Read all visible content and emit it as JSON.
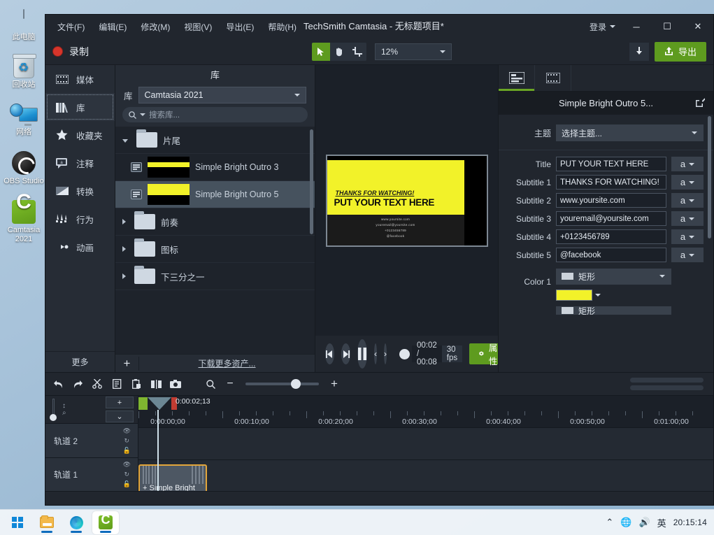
{
  "desktop": {
    "icons": [
      {
        "label": "此电脑",
        "icon": "this-pc-icon"
      },
      {
        "label": "回收站",
        "icon": "recycle-bin-icon"
      },
      {
        "label": "网络",
        "icon": "network-icon"
      },
      {
        "label": "OBS Studio",
        "icon": "obs-studio-icon"
      },
      {
        "label": "Camtasia 2021",
        "icon": "camtasia-icon"
      }
    ]
  },
  "taskbar": {
    "items": [
      {
        "name": "start-button",
        "icon": "windows-logo-icon"
      },
      {
        "name": "file-explorer",
        "icon": "folder-icon"
      },
      {
        "name": "microsoft-edge",
        "icon": "edge-icon"
      },
      {
        "name": "camtasia-taskbar",
        "icon": "camtasia-icon"
      }
    ],
    "tray": {
      "chevron": "⌃",
      "network": "network-icon",
      "volume": "volume-icon",
      "ime": "英"
    },
    "clock": "20:15:14"
  },
  "app": {
    "title": "TechSmith Camtasia - 无标题项目*",
    "menu": [
      "文件(F)",
      "编辑(E)",
      "修改(M)",
      "视图(V)",
      "导出(E)",
      "帮助(H)"
    ],
    "login": "登录",
    "window_buttons": {
      "minimize": "─",
      "maximize": "☐",
      "close": "✕"
    }
  },
  "toolbar": {
    "record": "录制",
    "zoom_value": "12%",
    "export": "导出",
    "tools": [
      "cursor-tool",
      "hand-tool",
      "crop-tool"
    ],
    "download_icon": "download-arrow-icon"
  },
  "rail": {
    "items": [
      {
        "label": "媒体",
        "icon": "media-icon",
        "active": false
      },
      {
        "label": "库",
        "icon": "library-icon",
        "active": true
      },
      {
        "label": "收藏夹",
        "icon": "star-icon",
        "active": false
      },
      {
        "label": "注释",
        "icon": "annotation-icon",
        "active": false
      },
      {
        "label": "转换",
        "icon": "transition-icon",
        "active": false
      },
      {
        "label": "行为",
        "icon": "behavior-icon",
        "active": false
      },
      {
        "label": "动画",
        "icon": "animation-icon",
        "active": false
      }
    ],
    "more": "更多"
  },
  "library": {
    "header": "库",
    "dropdown_label": "库",
    "dropdown_value": "Camtasia 2021",
    "search_placeholder": "搜索库...",
    "rows": [
      {
        "type": "folder",
        "label": "片尾",
        "expanded": true
      },
      {
        "type": "asset",
        "label": "Simple Bright Outro 3",
        "selected": false
      },
      {
        "type": "asset",
        "label": "Simple Bright Outro 5",
        "selected": true
      },
      {
        "type": "folder",
        "label": "前奏",
        "expanded": false
      },
      {
        "type": "folder",
        "label": "图标",
        "expanded": false
      },
      {
        "type": "folder",
        "label": "下三分之一",
        "expanded": false
      }
    ],
    "add_label": "+",
    "download_more": "下载更多资产..."
  },
  "canvas": {
    "subtitle_1": "THANKS FOR WATCHING!",
    "title": "PUT YOUR TEXT HERE",
    "subtitle_2": "www.yoursite.com",
    "subtitle_3": "youremail@yoursite.com",
    "subtitle_4": "+0123456789",
    "subtitle_5": "@facebook"
  },
  "player": {
    "prev_frame": "prev-frame-icon",
    "next_frame": "next-frame-icon",
    "pause": "pause-icon",
    "prev_marker": "‹",
    "next_marker": "›",
    "time": "00:02 / 00:08",
    "fps": "30 fps",
    "properties": "属性"
  },
  "properties": {
    "tabs": [
      {
        "name": "properties-tab",
        "icon": "properties-icon",
        "active": true
      },
      {
        "name": "captions-tab",
        "icon": "film-icon",
        "active": false
      }
    ],
    "title": "Simple Bright Outro 5...",
    "edit_icon": "edit-pencil-icon",
    "theme_label": "主题",
    "theme_value": "选择主题...",
    "fields": [
      {
        "label": "Title",
        "value": "PUT YOUR TEXT HERE"
      },
      {
        "label": "Subtitle 1",
        "value": "THANKS FOR WATCHING!"
      },
      {
        "label": "Subtitle 2",
        "value": "www.yoursite.com"
      },
      {
        "label": "Subtitle 3",
        "value": "youremail@yoursite.com"
      },
      {
        "label": "Subtitle 4",
        "value": "+0123456789"
      },
      {
        "label": "Subtitle 5",
        "value": "@facebook"
      }
    ],
    "font_button": "a",
    "color1_label": "Color 1",
    "color1_shape": "矩形",
    "color1_value": "#F2F229",
    "color2_shape": "矩形"
  },
  "timeline": {
    "tools": [
      "undo-icon",
      "redo-icon",
      "cut-icon",
      "copy-icon",
      "paste-icon",
      "split-icon",
      "camera-icon",
      "zoom-icon"
    ],
    "zoom_out": "−",
    "zoom_in": "+",
    "playhead_time": "0:00:02;13",
    "ruler_labels": [
      "0:00:00;00",
      "0:00:10;00",
      "0:00:20;00",
      "0:00:30;00",
      "0:00:40;00",
      "0:00:50;00",
      "0:01:00;00"
    ],
    "add_track": "+",
    "collapse": "⌄",
    "tracks": [
      {
        "name": "轨道 2",
        "clips": []
      },
      {
        "name": "轨道 1",
        "clips": [
          {
            "label": "Simple Bright",
            "prefix": "+"
          }
        ]
      }
    ]
  },
  "colors": {
    "accent_green": "#5E9B1F",
    "window_bg": "#21262e",
    "panel_bg": "#1b2028",
    "highlight_yellow": "#F2F229",
    "clip_border": "#e3a53a"
  }
}
